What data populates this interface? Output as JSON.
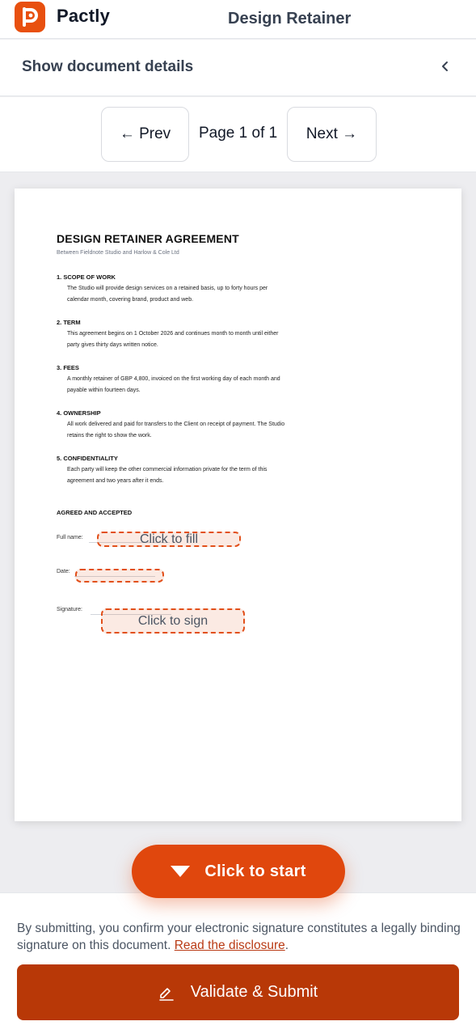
{
  "header": {
    "brand_name": "Pactly",
    "document_title": "Design Retainer"
  },
  "details": {
    "toggle_label": "Show document details"
  },
  "pager": {
    "prev_label": "← Prev",
    "page_text": "Page 1 of 1",
    "next_label": "Next →"
  },
  "document": {
    "title": "DESIGN RETAINER AGREEMENT",
    "subtitle": "Between Fieldnote Studio and Harlow & Cole Ltd",
    "sections": [
      {
        "heading": "1. SCOPE OF WORK",
        "body": "The Studio will provide design services on a retained basis, up to forty hours per calendar month, covering brand, product and web."
      },
      {
        "heading": "2. TERM",
        "body": "This agreement begins on 1 October 2026 and continues month to month until either party gives thirty days written notice."
      },
      {
        "heading": "3. FEES",
        "body": "A monthly retainer of GBP 4,800, invoiced on the first working day of each month and payable within fourteen days."
      },
      {
        "heading": "4. OWNERSHIP",
        "body": "All work delivered and paid for transfers to the Client on receipt of payment. The Studio retains the right to show the work."
      },
      {
        "heading": "5. CONFIDENTIALITY",
        "body": "Each party will keep the other commercial information private for the term of this agreement and two years after it ends."
      }
    ],
    "agreed_heading": "AGREED AND ACCEPTED",
    "full_name_label": "Full name:",
    "date_label": "Date:",
    "signature_label": "Signature:"
  },
  "fields": {
    "full_name_placeholder": "Click to fill",
    "date_placeholder": "",
    "signature_placeholder": "Click to sign"
  },
  "start_button": {
    "label": "Click to start"
  },
  "footer": {
    "disclaimer_text": "By submitting, you confirm your electronic signature constitutes a legally binding signature on this document. ",
    "disclosure_link": "Read the disclosure",
    "disclaimer_end": ".",
    "submit_label": "Validate & Submit"
  },
  "colors": {
    "brand": "#e8500f",
    "accent": "#e0470d",
    "submit": "#b83807",
    "field_border": "#e2501b"
  },
  "icons": {
    "logo": "pactly-logo-icon",
    "details_toggle": "chevron-left-icon",
    "start_button": "triangle-down-icon",
    "submit_button": "signature-pen-icon"
  }
}
